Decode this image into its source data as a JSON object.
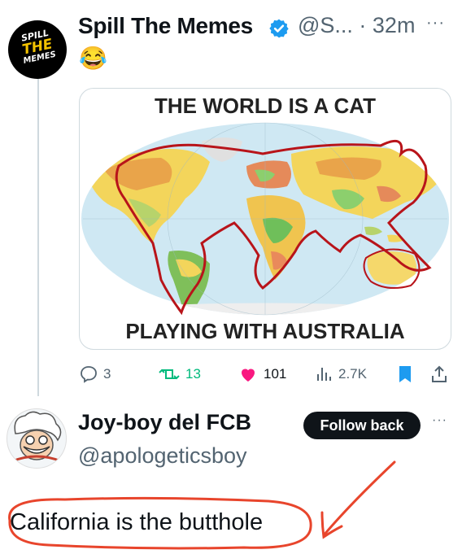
{
  "post": {
    "author_name": "Spill The Memes",
    "handle_time": "@S... · 32m",
    "more": "···",
    "text": "😂",
    "avatar_logo": [
      "SPILL",
      "THE",
      "MEMES"
    ],
    "verified": true,
    "image": {
      "top_caption": "THE WORLD IS A CAT",
      "bottom_caption": "PLAYING WITH AUSTRALIA"
    },
    "stats": {
      "replies": "3",
      "reposts": "13",
      "likes": "101",
      "views": "2.7K"
    },
    "colors": {
      "like": "#f91880",
      "repost": "#00ba7c",
      "bookmark": "#1d9bf0",
      "verified": "#1d9bf0"
    }
  },
  "reply": {
    "author_name": "Joy-boy del FCB",
    "handle": "@apologeticsboy",
    "follow_label": "Follow back",
    "more": "···",
    "text": "California is the butthole",
    "annotation_color": "#e8452c"
  }
}
